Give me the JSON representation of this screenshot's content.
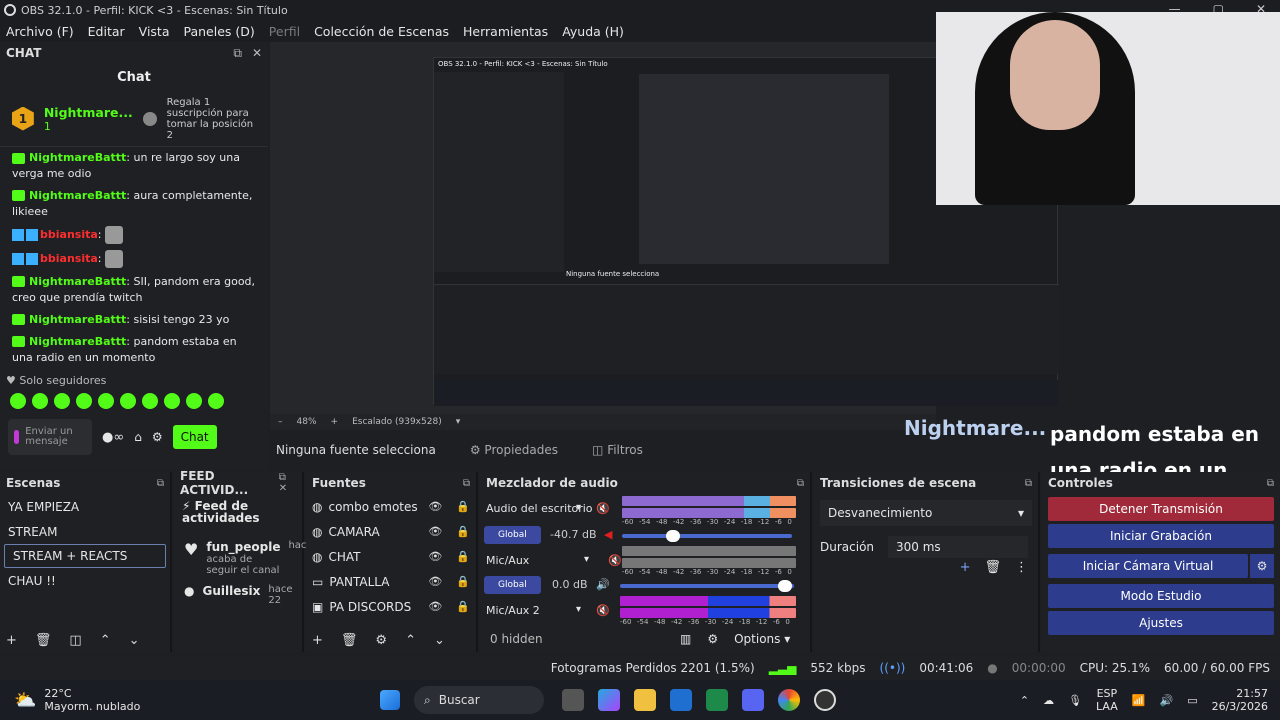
{
  "title": "OBS 32.1.0 - Perfil: KICK <3 - Escenas: Sin Título",
  "menu": [
    "Archivo (F)",
    "Editar",
    "Vista",
    "Paneles (D)",
    "Perfil",
    "Colección de Escenas",
    "Herramientas",
    "Ayuda (H)"
  ],
  "chat_dock": {
    "dock_title": "CHAT",
    "title": "Chat",
    "pinned": {
      "rank": "1",
      "name": "Nightmare...",
      "subs": "1",
      "gift_text": "Regala 1 suscripción para tomar la posición 2"
    },
    "messages": [
      {
        "user": "NightmareBattt",
        "text": ": un re largo soy una verga me odio"
      },
      {
        "user": "NightmareBattt",
        "text": ": aura completamente, likieee"
      },
      {
        "user": "bbiansita",
        "text": ":"
      },
      {
        "user": "bbiansita",
        "text": ":"
      },
      {
        "user": "NightmareBattt",
        "text": ": SII, pandom era good, creo que prendía twitch"
      },
      {
        "user": "NightmareBattt",
        "text": ": sisisi tengo 23 yo"
      },
      {
        "user": "NightmareBattt",
        "text": ": pandom estaba en una radio en un momento"
      }
    ],
    "followers_only": "Solo seguidores",
    "input_placeholder": "Enviar un mensaje",
    "send_label": "Chat"
  },
  "preview": {
    "nested_title": "OBS 32.1.0 - Perfil: KICK <3 - Escenas: Sin Título",
    "nested_no_source": "Ninguna fuente selecciona",
    "zoom": "48%",
    "scaling": "Escalado (939x528)"
  },
  "source_bar": {
    "none_selected": "Ninguna fuente selecciona",
    "properties": "Propiedades",
    "filters": "Filtros"
  },
  "overlay": {
    "name": "Nightmare...",
    "message": "pandom estaba en una radio en un momento"
  },
  "scenes": {
    "title": "Escenas",
    "items": [
      "YA EMPIEZA",
      "STREAM",
      "STREAM + REACTS",
      "CHAU !!"
    ],
    "selected": "STREAM + REACTS"
  },
  "feed": {
    "title": "FEED ACTIVID...",
    "header": "Feed de actividades",
    "items": [
      {
        "name": "fun_people",
        "time": "hace",
        "desc": "acaba de seguir el canal"
      },
      {
        "name": "Guillesix",
        "time": "hace 22",
        "desc": ""
      }
    ]
  },
  "sources": {
    "title": "Fuentes",
    "items": [
      "combo emotes",
      "CAMARA",
      "CHAT",
      "PANTALLA",
      "PA DISCORDS"
    ]
  },
  "mixer": {
    "title": "Mezclador de audio",
    "channels": [
      {
        "name": "Audio del escritorio",
        "scope": "Global",
        "db": "-40.7 dB"
      },
      {
        "name": "Mic/Aux",
        "scope": "Global",
        "db": "0.0 dB"
      },
      {
        "name": "Mic/Aux 2",
        "scope": "",
        "db": ""
      }
    ],
    "scale": [
      "-60",
      "-54",
      "-48",
      "-42",
      "-36",
      "-30",
      "-24",
      "-18",
      "-12",
      "-6",
      "0"
    ],
    "hidden": "0 hidden",
    "options": "Options"
  },
  "transitions": {
    "title": "Transiciones de escena",
    "selected": "Desvanecimiento",
    "duration_label": "Duración",
    "duration_value": "300 ms"
  },
  "controls": {
    "title": "Controles",
    "buttons": [
      "Detener Transmisión",
      "Iniciar Grabación",
      "Iniciar Cámara Virtual",
      "Modo Estudio",
      "Ajustes"
    ]
  },
  "status": {
    "dropped": "Fotogramas Perdidos 2201 (1.5%)",
    "kbps": "552 kbps",
    "stream_time": "00:41:06",
    "rec_time": "00:00:00",
    "cpu": "CPU: 25.1%",
    "fps": "60.00 / 60.00 FPS"
  },
  "taskbar": {
    "temp": "22°C",
    "weather": "Mayorm. nublado",
    "search": "Buscar",
    "lang1": "ESP",
    "lang2": "LAA",
    "time": "21:57",
    "date": "26/3/2026"
  },
  "colors": {
    "kick_green": "#53fc18",
    "accent_blue": "#2d3c8c",
    "stop_red": "#a02a3a"
  }
}
